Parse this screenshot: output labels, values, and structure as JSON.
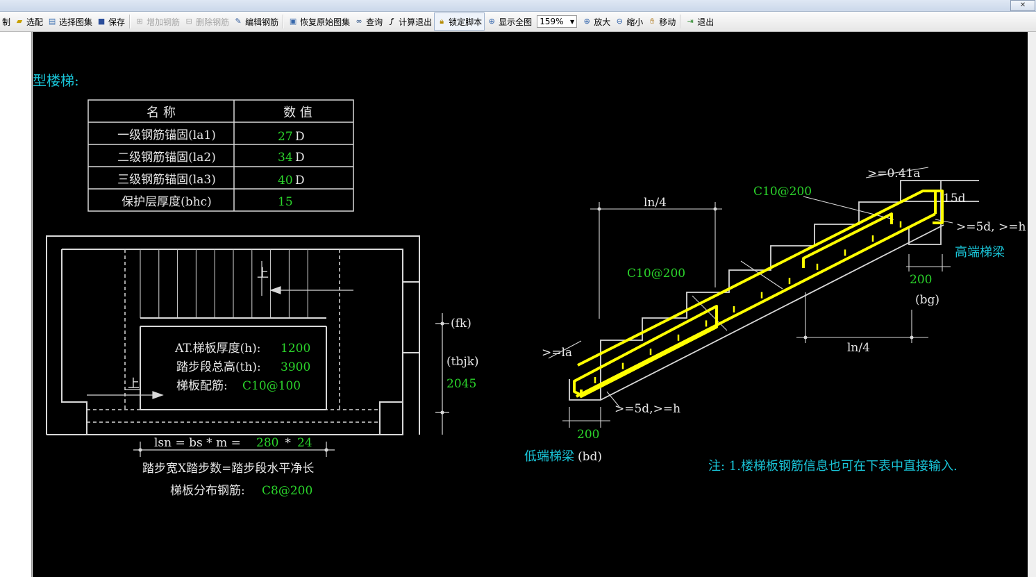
{
  "titlebar": {
    "close_glyph": "✕"
  },
  "toolbar": {
    "items": [
      {
        "label": "制",
        "icon": "none"
      },
      {
        "label": "选配",
        "icon": "select-icon"
      },
      {
        "label": "选择图集",
        "icon": "atlas-icon"
      },
      {
        "label": "保存",
        "icon": "save-icon"
      },
      {
        "label": "增加钢筋",
        "icon": "add-rebar-icon",
        "disabled": true
      },
      {
        "label": "删除钢筋",
        "icon": "delete-rebar-icon",
        "disabled": true
      },
      {
        "label": "编辑钢筋",
        "icon": "edit-rebar-icon"
      },
      {
        "label": "恢复原始图集",
        "icon": "restore-icon"
      },
      {
        "label": "查询",
        "icon": "binoculars-icon"
      },
      {
        "label": "计算退出",
        "icon": "fx-icon"
      },
      {
        "label": "锁定脚本",
        "icon": "lock-icon"
      },
      {
        "label": "显示全图",
        "icon": "zoom-extents-icon"
      },
      {
        "label": "放大",
        "icon": "zoom-in-icon"
      },
      {
        "label": "缩小",
        "icon": "zoom-out-icon"
      },
      {
        "label": "移动",
        "icon": "hand-icon"
      },
      {
        "label": "退出",
        "icon": "exit-icon"
      }
    ],
    "zoom_value": "159%"
  },
  "drawing": {
    "title": "型楼梯:",
    "table": {
      "headers": [
        "名  称",
        "数  值"
      ],
      "rows": [
        {
          "name": "一级钢筋锚固(la1)",
          "value": "27",
          "unit": "D"
        },
        {
          "name": "二级钢筋锚固(la2)",
          "value": "34",
          "unit": "D"
        },
        {
          "name": "三级钢筋锚固(la3)",
          "value": "40",
          "unit": "D"
        },
        {
          "name": "保护层厚度(bhc)",
          "value": "15",
          "unit": ""
        }
      ]
    },
    "plan": {
      "up_top": "上",
      "up_left": "上",
      "thickness_label": "AT.梯板厚度(h):",
      "thickness_value": "1200",
      "height_label": "踏步段总高(th):",
      "height_value": "3900",
      "rebar_label": "梯板配筋:",
      "rebar_value": "C10@100",
      "fk_label": "(fk)",
      "tbjk_label": "(tbjk)",
      "tbjk_value": "2045",
      "lsn_label": "lsn = bs * m = ",
      "bs_value": "280",
      "times": " * ",
      "m_value": "24",
      "formula_note": "踏步宽X踏步数=踏步段水平净长",
      "dist_label": "梯板分布钢筋:",
      "dist_value": "C8@200"
    },
    "section": {
      "top_rebar": "C10@200",
      "mid_rebar": "C10@200",
      "anchor_top": ">=0.41a",
      "d15": "15d",
      "top_lap": ">=5d, >=h",
      "high_beam": "高端梯梁",
      "bg_value": "200",
      "bg_label": "(bg)",
      "ln4_top": "ln/4",
      "ln4_bottom": "ln/4",
      "la_label": ">=la",
      "bottom_lap": ">=5d,>=h",
      "bd_value": "200",
      "low_beam": "低端梯梁",
      "bd_label": "(bd)",
      "note": "注: 1.楼梯板钢筋信息也可在下表中直接输入."
    }
  },
  "colors": {
    "canvas": "#000000",
    "line": "#d8d8d8",
    "cyan": "#19c3d6",
    "green": "#2bd42b",
    "yellow": "#ffff00",
    "white": "#e6e6e6"
  }
}
